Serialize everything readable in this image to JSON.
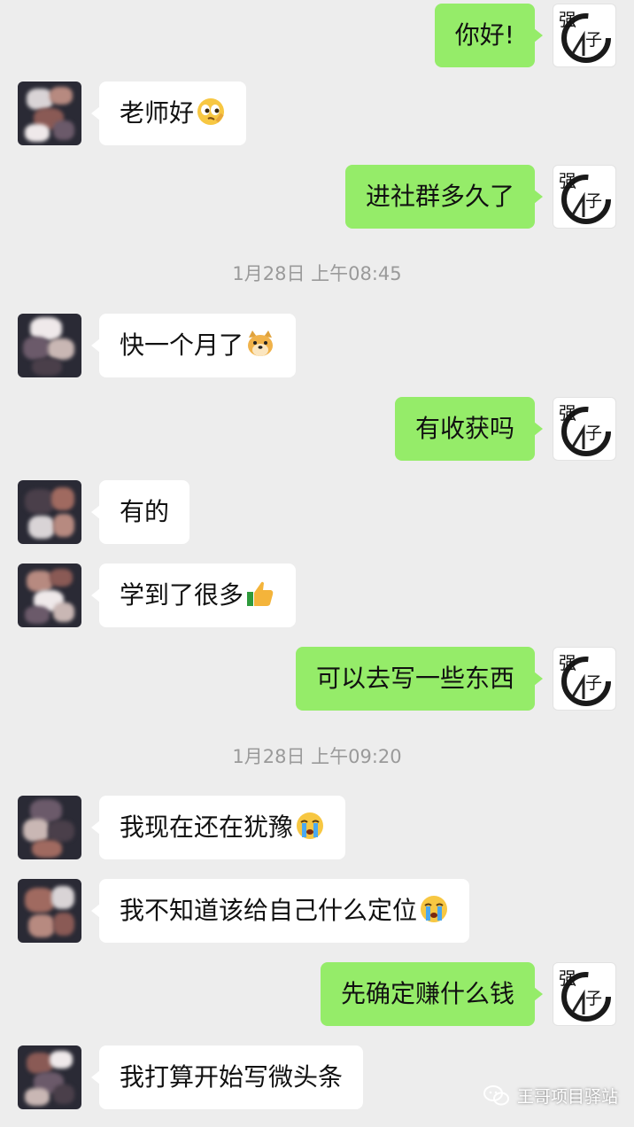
{
  "messages": [
    {
      "sender": "me",
      "text": "你好!"
    },
    {
      "sender": "other",
      "text": "老师好",
      "emoji": "eyes-emoji"
    },
    {
      "sender": "me",
      "text": "进社群多久了"
    },
    {
      "sender": "other",
      "text": "快一个月了",
      "emoji": "doge-emoji"
    },
    {
      "sender": "me",
      "text": "有收获吗"
    },
    {
      "sender": "other",
      "text": "有的"
    },
    {
      "sender": "other",
      "text": "学到了很多",
      "emoji": "thumbs-up-emoji"
    },
    {
      "sender": "me",
      "text": "可以去写一些东西"
    },
    {
      "sender": "other",
      "text": "我现在还在犹豫",
      "emoji": "crying-emoji"
    },
    {
      "sender": "other",
      "text": "我不知道该给自己什么定位",
      "emoji": "crying-emoji"
    },
    {
      "sender": "me",
      "text": "先确定赚什么钱"
    },
    {
      "sender": "other",
      "text": "我打算开始写微头条"
    }
  ],
  "timestamps": [
    "1月28日 上午08:45",
    "1月28日 上午09:20"
  ],
  "my_avatar": {
    "text": "强子",
    "icon": "ink-circle-avatar-icon"
  },
  "watermark": {
    "text": "王哥项目驿站",
    "icon": "wechat-icon"
  },
  "colors": {
    "background": "#ededed",
    "my_bubble": "#95ec69",
    "other_bubble": "#ffffff",
    "timestamp": "#9a9a9a"
  }
}
